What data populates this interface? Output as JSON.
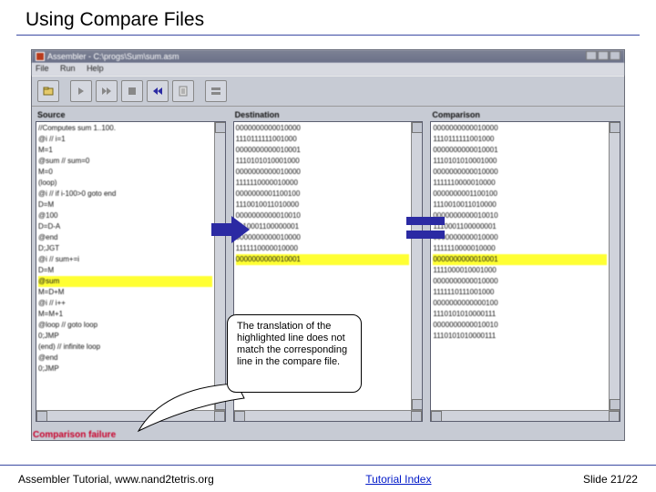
{
  "slide": {
    "title": "Using Compare Files",
    "footer_left": "Assembler Tutorial, www.nand2tetris.org",
    "footer_center_link": "Tutorial Index",
    "footer_right": "Slide 21/22"
  },
  "callout": {
    "text": "The translation of the highlighted line does not match the corresponding line in the compare file."
  },
  "status": {
    "error": "Comparison failure"
  },
  "app": {
    "title": "Assembler - C:\\progs\\Sum\\sum.asm",
    "menus": [
      "File",
      "Run",
      "Help"
    ],
    "toolbar": [
      {
        "name": "open-icon"
      },
      {
        "name": "step-icon"
      },
      {
        "name": "fast-forward-icon"
      },
      {
        "name": "stop-icon"
      },
      {
        "name": "rewind-icon"
      },
      {
        "name": "script-icon"
      },
      {
        "name": "compare-icon"
      }
    ],
    "panes": {
      "source": {
        "label": "Source",
        "lines": [
          "//Computes sum 1..100.",
          "  @i // i=1",
          "  M=1",
          "  @sum // sum=0",
          "  M=0",
          "(loop)",
          "  @i // if i-100>0 goto end",
          "  D=M",
          "  @100",
          "  D=D-A",
          "  @end",
          "  D;JGT",
          "  @i // sum+=i",
          "  D=M",
          "  @sum",
          "  M=D+M",
          "  @i // i++",
          "  M=M+1",
          "  @loop // goto loop",
          "  0;JMP",
          "(end) // infinite loop",
          "  @end",
          "  0;JMP"
        ],
        "highlight_index": 14
      },
      "destination": {
        "label": "Destination",
        "lines": [
          "0000000000010000",
          "1110111111001000",
          "0000000000010001",
          "1110101010001000",
          "0000000000010000",
          "1111110000010000",
          "0000000001100100",
          "1110010011010000",
          "0000000000010010",
          "1110001100000001",
          "0000000000010000",
          "1111110000010000",
          "0000000000010001"
        ],
        "highlight_index": 12
      },
      "comparison": {
        "label": "Comparison",
        "lines": [
          "0000000000010000",
          "1110111111001000",
          "0000000000010001",
          "1110101010001000",
          "0000000000010000",
          "1111110000010000",
          "0000000001100100",
          "1110010011010000",
          "0000000000010010",
          "1110001100000001",
          "0000000000010000",
          "1111110000010000",
          "0000000000010001",
          "1111000010001000",
          "0000000000010000",
          "1111110111001000",
          "0000000000000100",
          "1110101010000111",
          "0000000000010010",
          "1110101010000111"
        ],
        "highlight_index": 12
      }
    }
  }
}
